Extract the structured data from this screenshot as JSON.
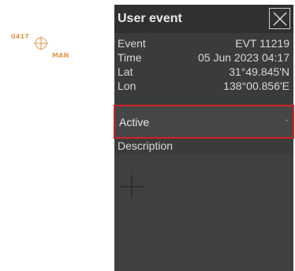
{
  "map_marker": {
    "time": "0417",
    "label": "MAN",
    "color": "#e39a4c",
    "icon": "crosshair-circle-icon"
  },
  "panel": {
    "title": "User event",
    "close_icon": "close-icon",
    "fields": [
      {
        "label": "Event",
        "value": "EVT 11219"
      },
      {
        "label": "Time",
        "value": "05 Jun 2023 04:17"
      },
      {
        "label": "Lat",
        "value": "31°49.845'N"
      },
      {
        "label": "Lon",
        "value": "138°00.856'E"
      }
    ],
    "status": {
      "selected": "Active",
      "chevron": "-",
      "highlight_color": "#d61f26"
    },
    "description": {
      "label": "Description",
      "value": ""
    }
  }
}
